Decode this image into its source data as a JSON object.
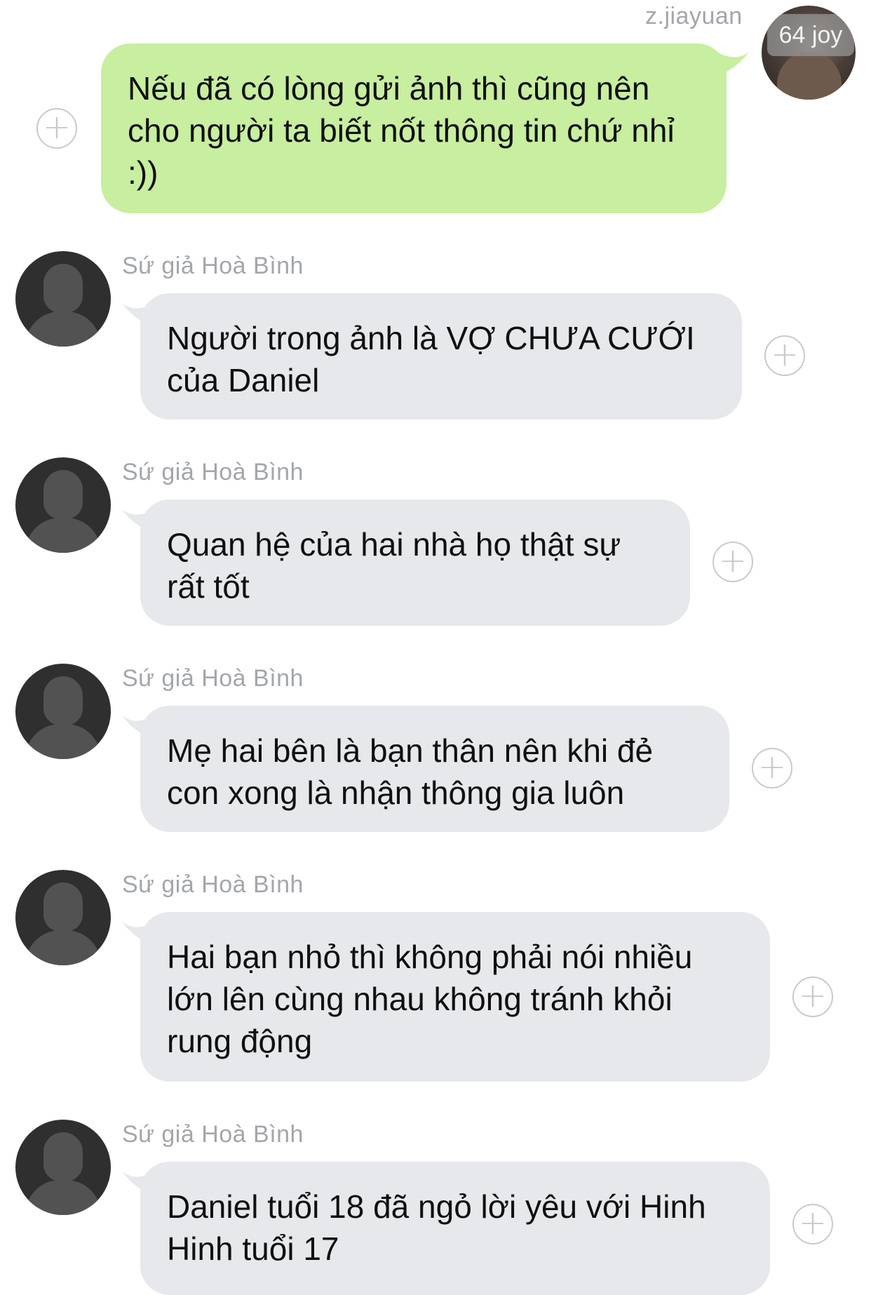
{
  "conversation": {
    "outgoing": {
      "sender": "z.jiayuan",
      "avatar_badge": "64 joy",
      "text": "Nếu đã có lòng gửi ảnh thì cũng nên cho người ta biết nốt thông tin chứ nhỉ :))",
      "plus_icon": "+"
    },
    "incoming": [
      {
        "sender": "Sứ giả Hoà Bình",
        "text": "Người trong ảnh là VỢ CHƯA CƯỚI của Daniel",
        "plus_icon": "+"
      },
      {
        "sender": "Sứ giả Hoà Bình",
        "text": "Quan hệ của hai nhà họ thật sự rất tốt",
        "plus_icon": "+"
      },
      {
        "sender": "Sứ giả Hoà Bình",
        "text": "Mẹ hai bên là bạn thân nên khi đẻ con xong là nhận thông gia luôn",
        "plus_icon": "+"
      },
      {
        "sender": "Sứ giả Hoà Bình",
        "text": "Hai bạn nhỏ thì không phải nói nhiều lớn lên cùng nhau không tránh khỏi rung động",
        "plus_icon": "+"
      },
      {
        "sender": "Sứ giả Hoà Bình",
        "text": "Daniel tuổi 18 đã ngỏ lời yêu với Hinh Hinh tuổi 17",
        "plus_icon": "+"
      }
    ]
  },
  "colors": {
    "outgoing_bubble": "#c8eea0",
    "incoming_bubble": "#e6e8eb",
    "name_text": "#a3a6ab",
    "plus_icon": "#c8cacd"
  },
  "icons": {
    "plus": "plus-circle-icon",
    "default_avatar": "default-person-avatar-icon"
  }
}
